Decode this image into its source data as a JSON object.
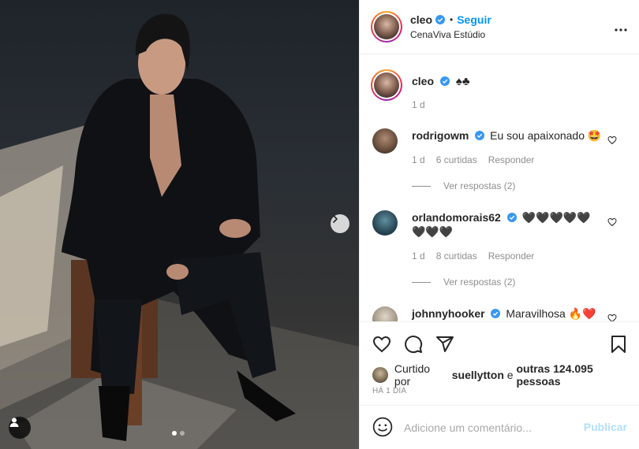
{
  "post": {
    "author": "cleo",
    "follow_label": "Seguir",
    "separator": "•",
    "location": "CenaViva Estúdio",
    "carousel_pages": 2,
    "carousel_active": 1
  },
  "caption": {
    "author": "cleo",
    "text": "♠♣",
    "age": "1 d"
  },
  "comments": [
    {
      "author": "rodrigowm",
      "text": "Eu sou apaixonado 🤩",
      "age": "1 d",
      "likes": "6 curtidas",
      "reply": "Responder",
      "view_replies": "Ver respostas (2)"
    },
    {
      "author": "orlandomorais62",
      "text": "🖤🖤🖤🖤🖤",
      "text2": "🖤🖤🖤",
      "age": "1 d",
      "likes": "8 curtidas",
      "reply": "Responder",
      "view_replies": "Ver respostas (2)"
    },
    {
      "author": "johnnyhooker",
      "text": "Maravilhosa 🔥❤️"
    }
  ],
  "likes": {
    "prefix": "Curtido por",
    "user": "suellytton",
    "middle": "e",
    "others": "outras 124.095 pessoas"
  },
  "timestamp": "HÁ 1 DIA",
  "compose": {
    "placeholder": "Adicione um comentário...",
    "publish": "Publicar"
  },
  "colors": {
    "accent": "#0095f6",
    "verified": "#3897f0",
    "publish_disabled": "#b2dffc"
  },
  "icons": [
    "chevron-right-icon",
    "user-tag-icon",
    "verified-badge-icon",
    "more-options-icon",
    "heart-icon",
    "comment-icon",
    "share-icon",
    "save-icon",
    "emoji-icon"
  ]
}
